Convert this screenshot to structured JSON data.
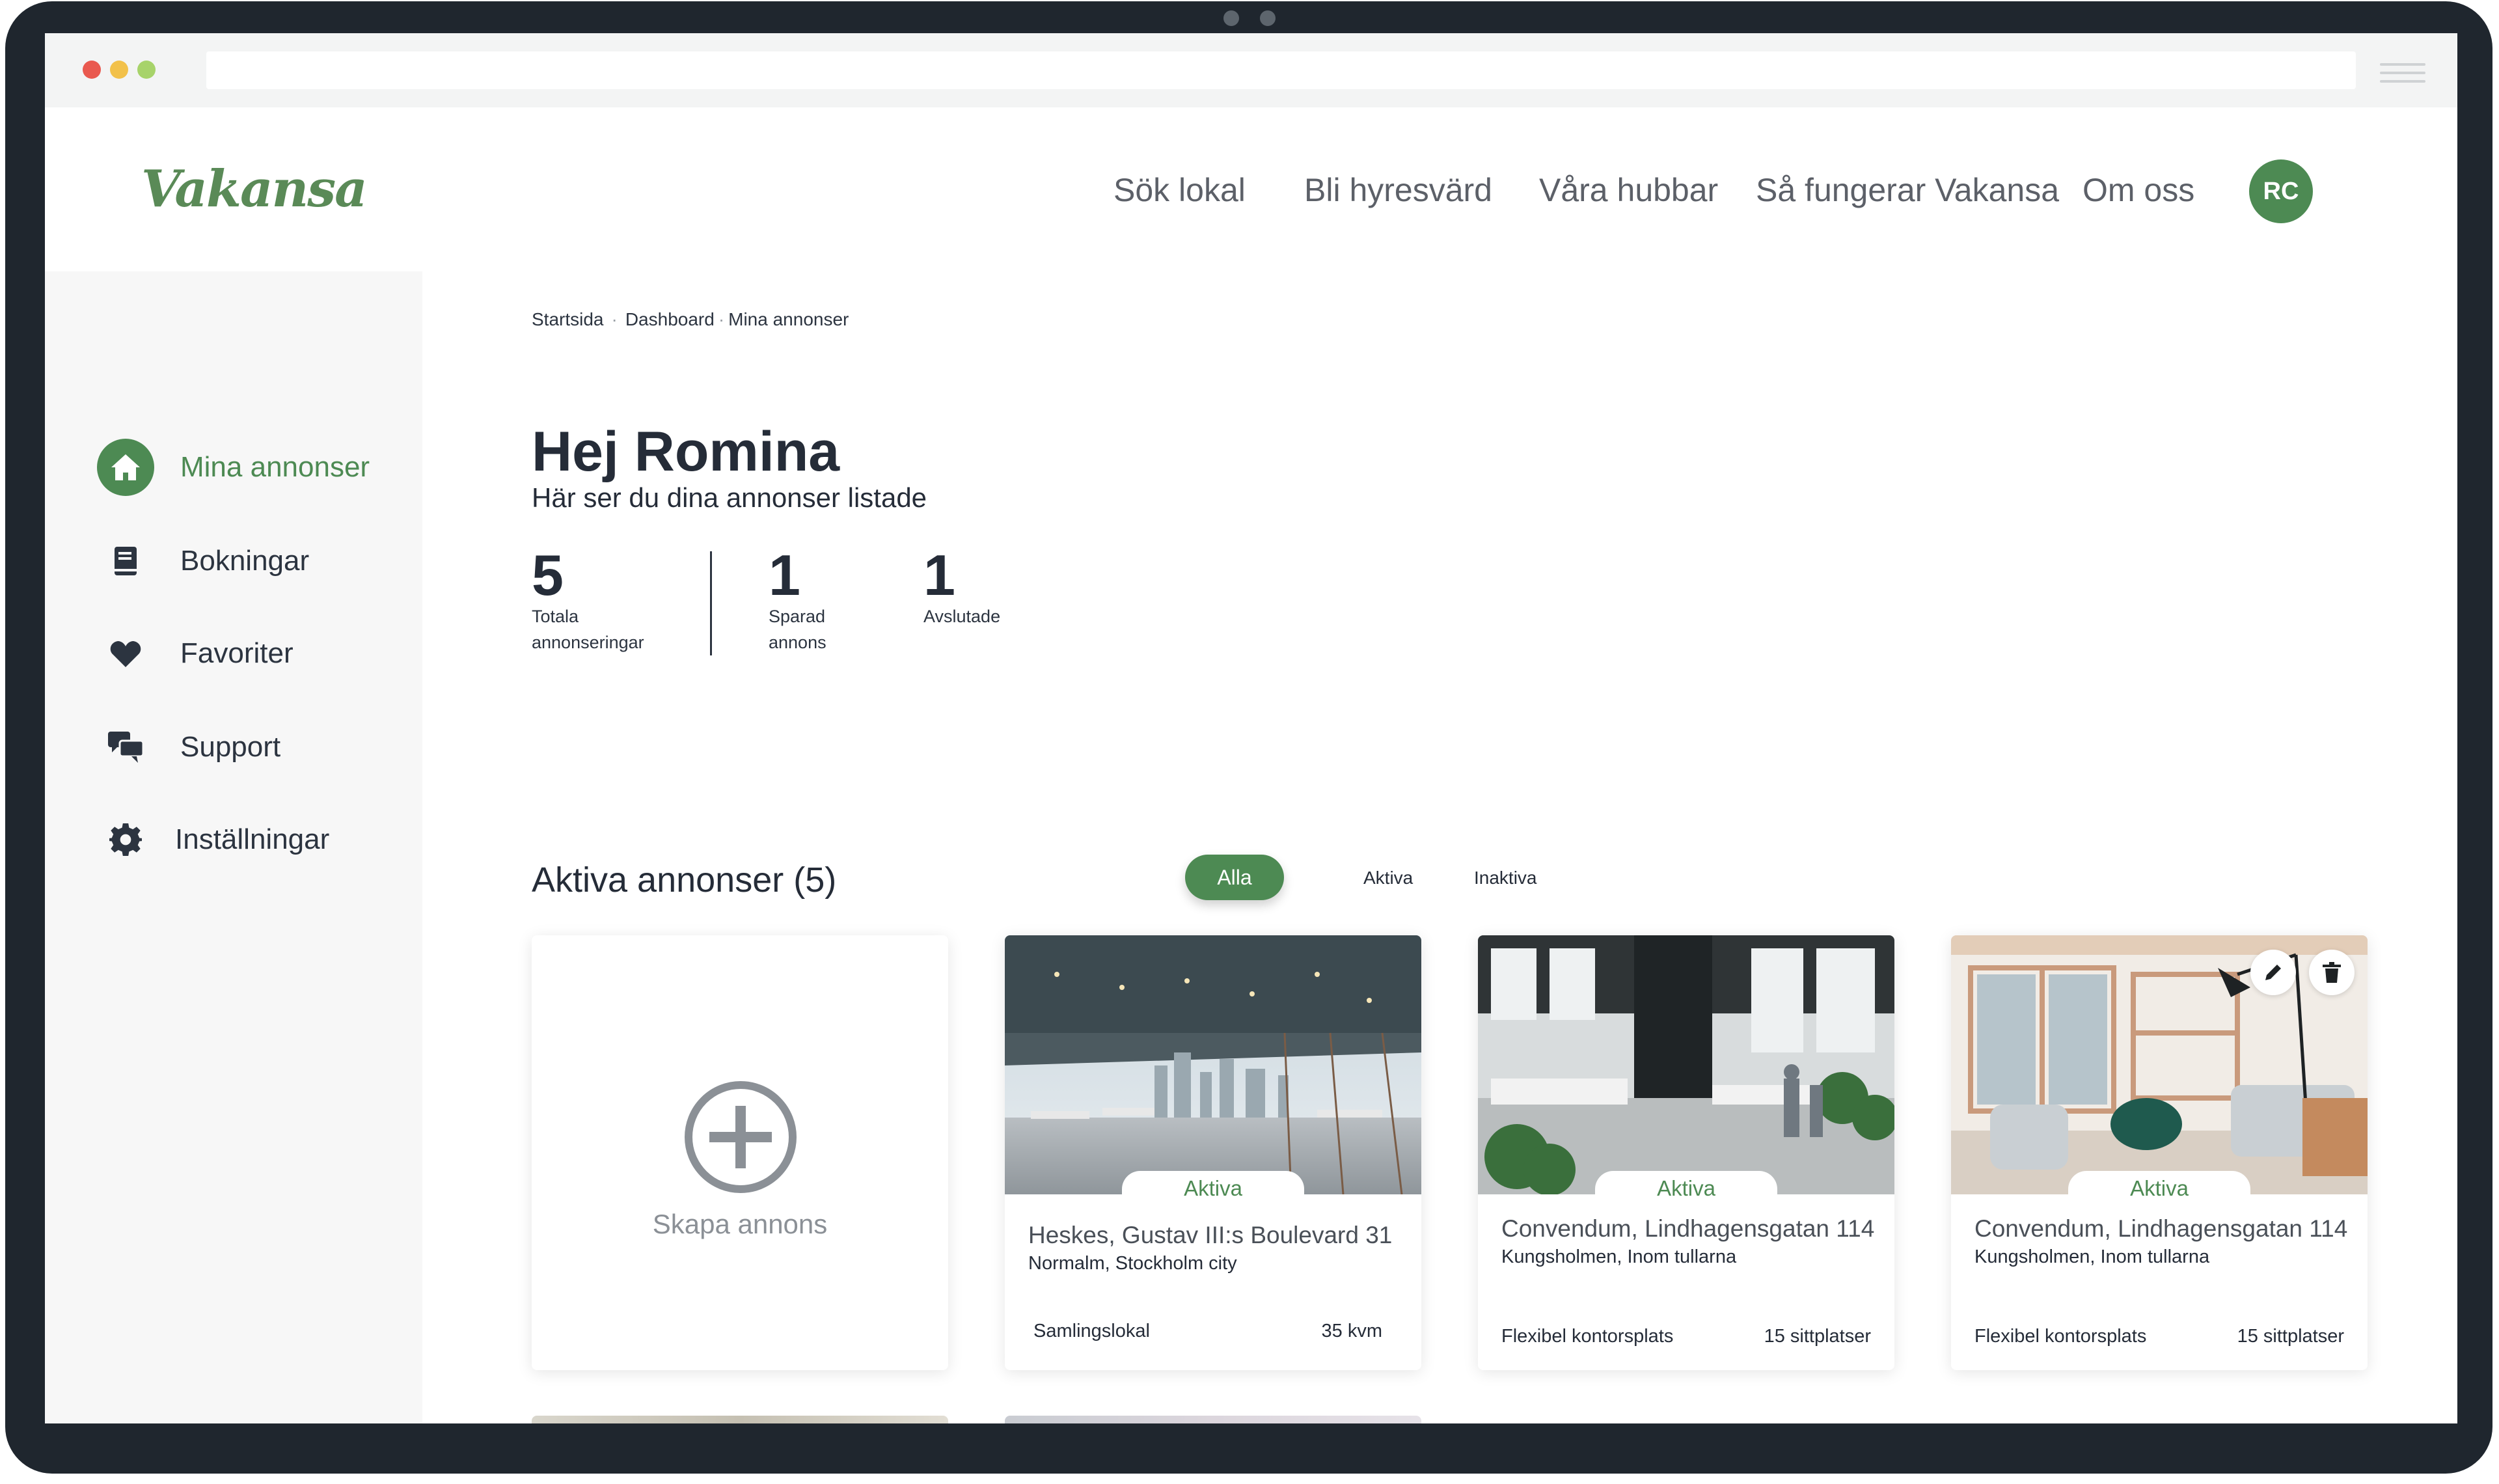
{
  "header": {
    "logo": "Vakansa",
    "nav": [
      "Sök lokal",
      "Bli hyresvärd",
      "Våra hubbar",
      "Så fungerar Vakansa",
      "Om oss"
    ],
    "avatar_initials": "RC"
  },
  "sidebar": {
    "items": [
      {
        "label": "Mina annonser",
        "icon": "home-icon",
        "active": true
      },
      {
        "label": "Bokningar",
        "icon": "book-icon",
        "active": false
      },
      {
        "label": "Favoriter",
        "icon": "heart-icon",
        "active": false
      },
      {
        "label": "Support",
        "icon": "chat-bubbles-icon",
        "active": false
      },
      {
        "label": "Inställningar",
        "icon": "gear-icon",
        "active": false
      }
    ]
  },
  "breadcrumb": [
    "Startsida",
    "Dashboard",
    "Mina annonser"
  ],
  "greeting": {
    "title": "Hej Romina",
    "subtitle": "Här ser du dina annonser listade"
  },
  "stats": [
    {
      "value": "5",
      "label": "Totala annonseringar"
    },
    {
      "value": "1",
      "label": "Sparad annons"
    },
    {
      "value": "1",
      "label": "Avslutade"
    }
  ],
  "listings_section": {
    "title": "Aktiva annonser (5)",
    "filters": [
      "Alla",
      "Aktiva",
      "Inaktiva"
    ],
    "active_filter": "Alla"
  },
  "create_card": {
    "label": "Skapa annons"
  },
  "listings": [
    {
      "status": "Aktiva",
      "title": "Heskes,  Gustav III:s Boulevard 31",
      "area": "Normalm, Stockholm city",
      "type": "Samlingslokal",
      "meta": "35 kvm"
    },
    {
      "status": "Aktiva",
      "title": "Convendum, Lindhagensgatan 114",
      "area": "Kungsholmen, Inom tullarna",
      "type": "Flexibel kontorsplats",
      "meta": "15 sittplatser"
    },
    {
      "status": "Aktiva",
      "title": "Convendum, Lindhagensgatan 114",
      "area": "Kungsholmen, Inom tullarna",
      "type": "Flexibel kontorsplats",
      "meta": "15 sittplatser"
    }
  ],
  "colors": {
    "brand_green": "#4d8a53",
    "text_dark": "#252c38",
    "sidebar_bg": "#f7f7f7"
  }
}
